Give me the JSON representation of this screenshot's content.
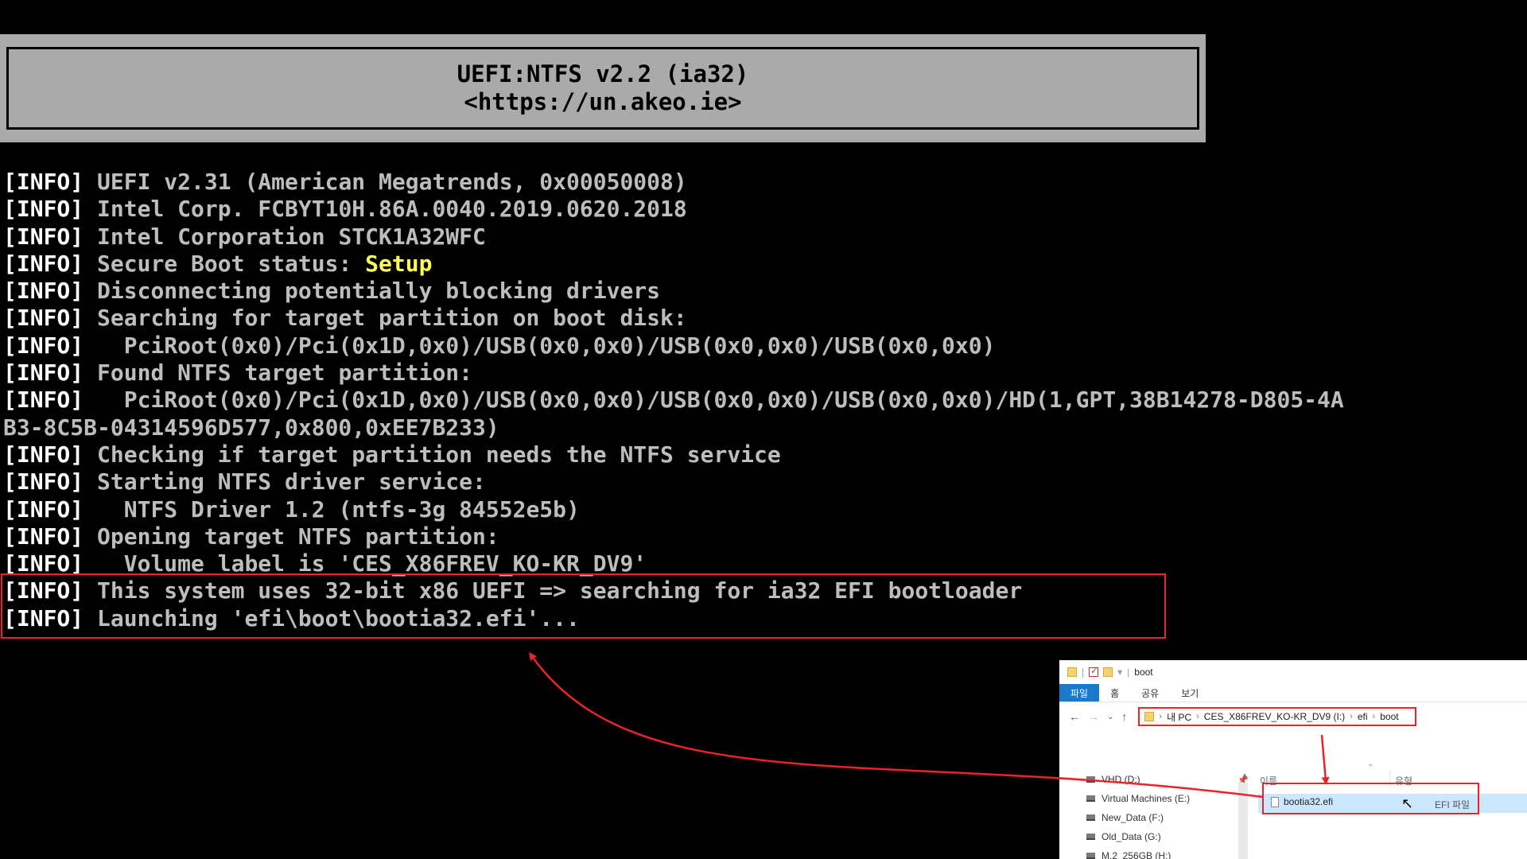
{
  "console": {
    "banner": {
      "title": "UEFI:NTFS v2.2 (ia32)",
      "url": "<https://un.akeo.ie>"
    },
    "lines": [
      {
        "tag": "[INFO]",
        "text": " UEFI v2.31 (American Megatrends, 0x00050008)"
      },
      {
        "tag": "[INFO]",
        "text": " Intel Corp. FCBYT10H.86A.0040.2019.0620.2018"
      },
      {
        "tag": "[INFO]",
        "text": " Intel Corporation STCK1A32WFC"
      },
      {
        "tag": "[INFO]",
        "text": " Secure Boot status: ",
        "highlight": "Setup"
      },
      {
        "tag": "[INFO]",
        "text": " Disconnecting potentially blocking drivers"
      },
      {
        "tag": "[INFO]",
        "text": " Searching for target partition on boot disk:"
      },
      {
        "tag": "[INFO]",
        "text": "   PciRoot(0x0)/Pci(0x1D,0x0)/USB(0x0,0x0)/USB(0x0,0x0)/USB(0x0,0x0)"
      },
      {
        "tag": "[INFO]",
        "text": " Found NTFS target partition:"
      },
      {
        "tag": "[INFO]",
        "text": "   PciRoot(0x0)/Pci(0x1D,0x0)/USB(0x0,0x0)/USB(0x0,0x0)/USB(0x0,0x0)/HD(1,GPT,38B14278-D805-4A"
      },
      {
        "tag": "",
        "text": "B3-8C5B-04314596D577,0x800,0xEE7B233)"
      },
      {
        "tag": "[INFO]",
        "text": " Checking if target partition needs the NTFS service"
      },
      {
        "tag": "[INFO]",
        "text": " Starting NTFS driver service:"
      },
      {
        "tag": "[INFO]",
        "text": "   NTFS Driver 1.2 (ntfs-3g 84552e5b)"
      },
      {
        "tag": "[INFO]",
        "text": " Opening target NTFS partition:"
      },
      {
        "tag": "[INFO]",
        "text": "   Volume label is 'CES_X86FREV_KO-KR_DV9'"
      },
      {
        "tag": "[INFO]",
        "text": " This system uses 32-bit x86 UEFI => searching for ia32 EFI bootloader"
      },
      {
        "tag": "[INFO]",
        "text": " Launching 'efi\\boot\\bootia32.efi'..."
      }
    ]
  },
  "explorer": {
    "title": "boot",
    "ribbon_tabs": [
      "파일",
      "홈",
      "공유",
      "보기"
    ],
    "breadcrumbs": [
      "내 PC",
      "CES_X86FREV_KO-KR_DV9 (I:)",
      "efi",
      "boot"
    ],
    "drives": [
      {
        "label": "VHD (D:)"
      },
      {
        "label": "Virtual Machines (E:)"
      },
      {
        "label": "New_Data (F:)"
      },
      {
        "label": "Old_Data (G:)"
      },
      {
        "label": "M.2_256GB (H:)"
      }
    ],
    "columns": {
      "name": "이름",
      "type": "유형"
    },
    "file": {
      "name": "bootia32.efi",
      "type": "EFI 파일"
    }
  },
  "colors": {
    "annotation": "#e8232a",
    "console_text": "#bdbdbd",
    "highlight": "#ffff55",
    "banner_bg": "#aaaaaa",
    "ribbon_file_tab": "#1979ca"
  }
}
